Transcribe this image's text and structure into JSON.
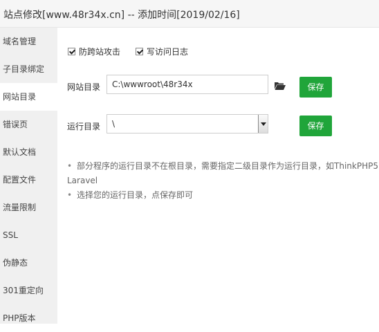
{
  "window": {
    "title": "站点修改[www.48r34x.cn] -- 添加时间[2019/02/16]"
  },
  "sidebar": {
    "items": [
      {
        "label": "域名管理"
      },
      {
        "label": "子目录绑定"
      },
      {
        "label": "网站目录"
      },
      {
        "label": "错误页"
      },
      {
        "label": "默认文档"
      },
      {
        "label": "配置文件"
      },
      {
        "label": "流量限制"
      },
      {
        "label": "SSL"
      },
      {
        "label": "伪静态"
      },
      {
        "label": "301重定向"
      },
      {
        "label": "PHP版本"
      }
    ],
    "active_index": 2
  },
  "options": {
    "anti_xss": {
      "label": "防跨站攻击",
      "checked": true
    },
    "access_log": {
      "label": "写访问日志",
      "checked": true
    }
  },
  "site_dir": {
    "label": "网站目录",
    "value": "C:\\wwwroot\\48r34x",
    "save_label": "保存",
    "icon": "folder-open-icon"
  },
  "run_dir": {
    "label": "运行目录",
    "value": "\\",
    "save_label": "保存"
  },
  "tips": {
    "bullet": "•",
    "items": [
      "部分程序的运行目录不在根目录，需要指定二级目录作为运行目录，如ThinkPHP5",
      "Laravel",
      "选择您的运行目录，点保存即可"
    ]
  },
  "colors": {
    "accent": "#20a53a",
    "sidebar_bg": "#f0f0f0",
    "titlebar_bg": "#f6f6f6"
  }
}
